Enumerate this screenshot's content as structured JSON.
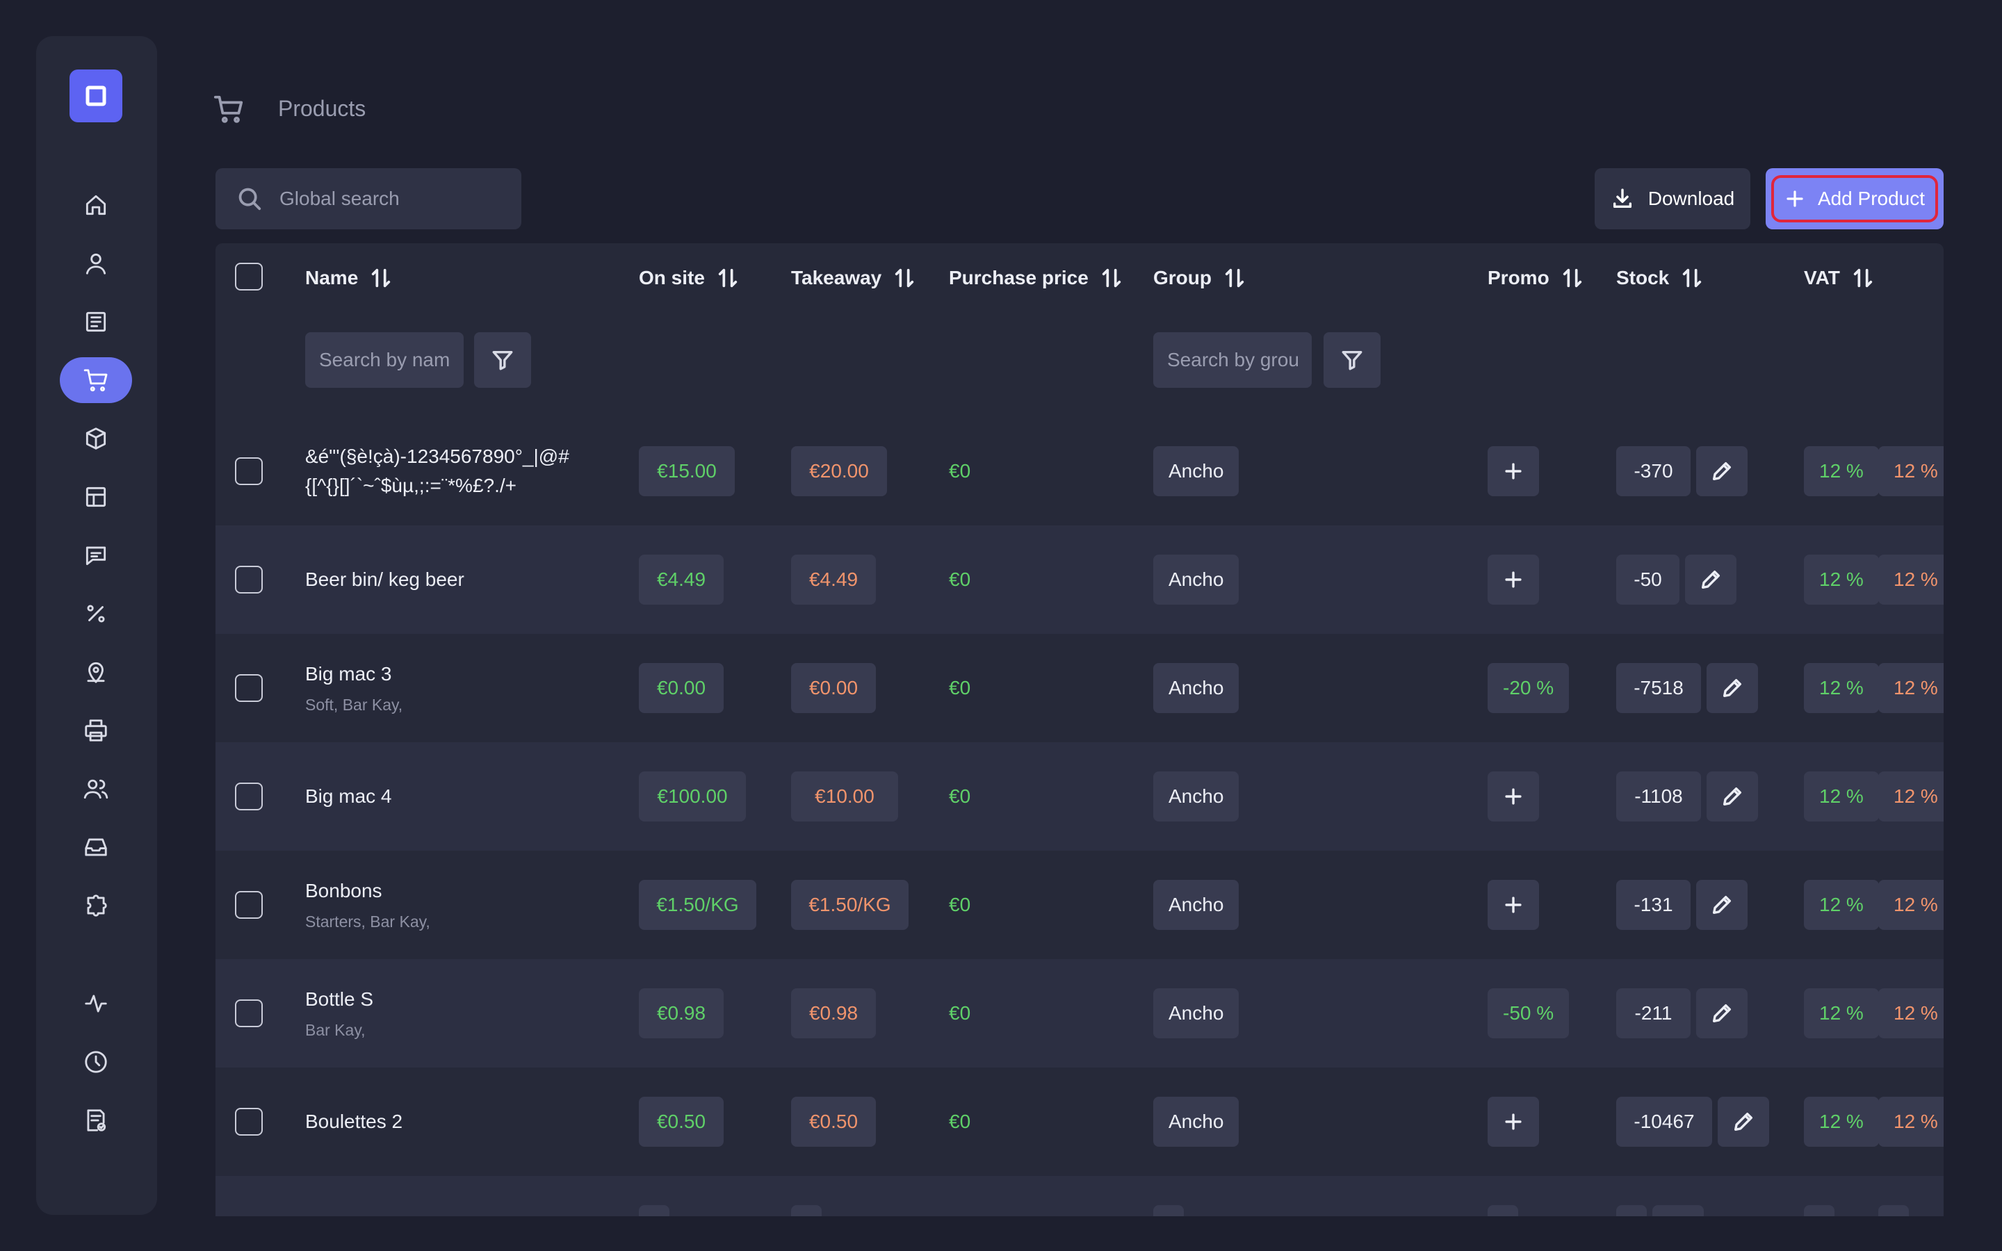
{
  "app": {
    "page_title": "Products",
    "page_icon": "cart-icon"
  },
  "sidebar": {
    "logo": "app-logo",
    "items": [
      {
        "icon": "home-icon",
        "active": false
      },
      {
        "icon": "user-icon",
        "active": false
      },
      {
        "icon": "list-icon",
        "active": false
      },
      {
        "icon": "cart-icon",
        "active": true
      },
      {
        "icon": "box-icon",
        "active": false
      },
      {
        "icon": "table-icon",
        "active": false
      },
      {
        "icon": "message-icon",
        "active": false
      },
      {
        "icon": "percent-icon",
        "active": false
      },
      {
        "icon": "location-icon",
        "active": false
      },
      {
        "icon": "printer-icon",
        "active": false
      },
      {
        "icon": "users-icon",
        "active": false
      },
      {
        "icon": "inbox-icon",
        "active": false
      },
      {
        "icon": "puzzle-icon",
        "active": false
      },
      {
        "icon": "activity-icon",
        "active": false
      },
      {
        "icon": "clock-icon",
        "active": false
      },
      {
        "icon": "report-icon",
        "active": false
      }
    ]
  },
  "toolbar": {
    "search_placeholder": "Global search",
    "download_label": "Download",
    "add_label": "Add Product"
  },
  "table": {
    "columns": {
      "name": "Name",
      "onsite": "On site",
      "takeaway": "Takeaway",
      "purchase": "Purchase price",
      "group": "Group",
      "promo": "Promo",
      "stock": "Stock",
      "vat": "VAT"
    },
    "filters": {
      "name_placeholder": "Search by name",
      "group_placeholder": "Search by group"
    },
    "rows": [
      {
        "name": "&é\"'(§è!çà)-1234567890°_|@#\n{[^{}[]´`~ˆ$ùµ,;:=¨*%£?./+",
        "sub": "",
        "onsite": "€15.00",
        "takeaway": "€20.00",
        "purchase": "€0",
        "group": "Ancho",
        "promo": "+",
        "stock": "-370",
        "vat_onsite": "12 %",
        "vat_takeaway": "12 %"
      },
      {
        "name": "Beer bin/ keg beer",
        "sub": "",
        "onsite": "€4.49",
        "takeaway": "€4.49",
        "purchase": "€0",
        "group": "Ancho",
        "promo": "+",
        "stock": "-50",
        "vat_onsite": "12 %",
        "vat_takeaway": "12 %"
      },
      {
        "name": "Big mac 3",
        "sub": "Soft, Bar Kay,",
        "onsite": "€0.00",
        "takeaway": "€0.00",
        "purchase": "€0",
        "group": "Ancho",
        "promo": "-20 %",
        "stock": "-7518",
        "vat_onsite": "12 %",
        "vat_takeaway": "12 %"
      },
      {
        "name": "Big mac 4",
        "sub": "",
        "onsite": "€100.00",
        "takeaway": "€10.00",
        "purchase": "€0",
        "group": "Ancho",
        "promo": "+",
        "stock": "-1108",
        "vat_onsite": "12 %",
        "vat_takeaway": "12 %"
      },
      {
        "name": "Bonbons",
        "sub": "Starters, Bar Kay,",
        "onsite": "€1.50/KG",
        "takeaway": "€1.50/KG",
        "purchase": "€0",
        "group": "Ancho",
        "promo": "+",
        "stock": "-131",
        "vat_onsite": "12 %",
        "vat_takeaway": "12 %"
      },
      {
        "name": "Bottle S",
        "sub": "Bar Kay,",
        "onsite": "€0.98",
        "takeaway": "€0.98",
        "purchase": "€0",
        "group": "Ancho",
        "promo": "-50 %",
        "stock": "-211",
        "vat_onsite": "12 %",
        "vat_takeaway": "12 %"
      },
      {
        "name": "Boulettes 2",
        "sub": "",
        "onsite": "€0.50",
        "takeaway": "€0.50",
        "purchase": "€0",
        "group": "Ancho",
        "promo": "+",
        "stock": "-10467",
        "vat_onsite": "12 %",
        "vat_takeaway": "12 %"
      },
      {
        "name": "",
        "sub": "",
        "onsite": "",
        "takeaway": "",
        "purchase": "",
        "group": "",
        "promo": "",
        "stock": "",
        "vat_onsite": "",
        "vat_takeaway": ""
      }
    ]
  },
  "colors": {
    "background": "#1d1f2e",
    "panel": "#262939",
    "accent": "#6a73ee",
    "price_onsite": "#5fd068",
    "price_takeaway": "#f1946c",
    "highlight_border": "#e0263c"
  }
}
